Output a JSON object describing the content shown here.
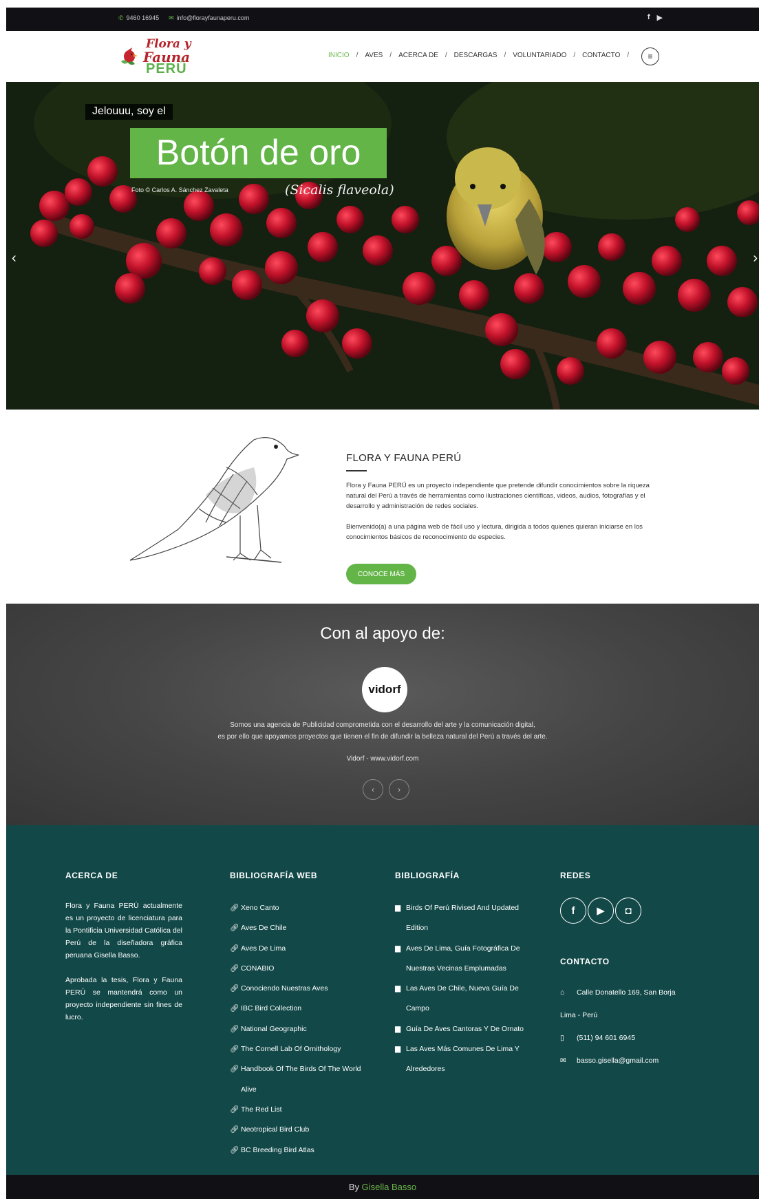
{
  "topbar": {
    "phone": "9460 16945",
    "email": "info@florayfaunaperu.com",
    "social_facebook": "f",
    "social_youtube": "▶"
  },
  "logo": {
    "line1": "Flora y",
    "line2": "Fauna",
    "line3": "PERÚ"
  },
  "nav": {
    "items": [
      "INICIO",
      "AVES",
      "ACERCA DE",
      "DESCARGAS",
      "VOLUNTARIADO",
      "CONTACTO"
    ],
    "separator": "/"
  },
  "hero": {
    "greeting": "Jelouuu, soy el",
    "title": "Botón de oro",
    "scientific": "(Sicalis flaveola)",
    "credit": "Foto © Carlos A. Sánchez Zavaleta",
    "prev": "‹",
    "next": "›"
  },
  "about": {
    "heading": "FLORA Y FAUNA PERÚ",
    "p1": "Flora y Fauna PERÚ es un proyecto independiente que pretende difundir conocimientos sobre la riqueza natural del Perú a través de herramientas como ilustraciones científicas, videos, audios, fotografías y el desarrollo y administración de redes sociales.",
    "p2": "Bienvenido(a) a una página web de fácil uso y lectura, dirigida a todos quienes quieran iniciarse en los conocimientos básicos de reconocimiento de especies.",
    "button": "CONOCE MÁS"
  },
  "support": {
    "heading": "Con al apoyo de:",
    "logo_text": "vidorf",
    "line1": "Somos una agencia de Publicidad comprometida con el desarrollo del arte y la comunicación digital,",
    "line2": "es por ello que apoyamos proyectos que tienen el fin de difundir la belleza natural del Perú a través del arte.",
    "credit": "Vidorf - www.vidorf.com",
    "prev": "‹",
    "next": "›"
  },
  "footer": {
    "about_heading": "ACERCA DE",
    "about_p1": "Flora y Fauna PERÚ actualmente es un proyecto de licenciatura para la Pontificia Universidad Católica del Perú de la diseñadora gráfica peruana Gisella Basso.",
    "about_p2": "Aprobada la tesis, Flora y Fauna PERÚ se mantendrá como un proyecto independiente sin fines de lucro.",
    "web_heading": "BIBLIOGRAFÍA WEB",
    "web_links": [
      "Xeno Canto",
      "Aves De Chile",
      "Aves De Lima",
      "CONABIO",
      "Conociendo Nuestras Aves",
      "IBC Bird Collection",
      "National Geographic",
      "The Cornell Lab Of Ornithology",
      "Handbook Of The Birds Of The World Alive",
      "The Red List",
      "Neotropical Bird Club",
      "BC Breeding Bird Atlas"
    ],
    "bib_heading": "BIBLIOGRAFÍA",
    "books": [
      "Birds Of Perú Rivised And Updated Edition",
      "Aves De Lima, Guía Fotográfica De Nuestras Vecinas Emplumadas",
      "Las Aves De Chile, Nueva Guía De Campo",
      "Guía De Aves Cantoras Y De Ornato",
      "Las Aves Más Comunes De Lima Y Alrededores"
    ],
    "redes_heading": "REDES",
    "contact_heading": "CONTACTO",
    "address1": "Calle Donatello 169, San Borja",
    "address2": "Lima - Perú",
    "phone": "(511) 94 601 6945",
    "email": "basso.gisella@gmail.com"
  },
  "bottom": {
    "by": "By",
    "name": "Gisella Basso"
  },
  "colors": {
    "accent": "#63b548",
    "footer": "#134848",
    "topbar": "#111015"
  }
}
